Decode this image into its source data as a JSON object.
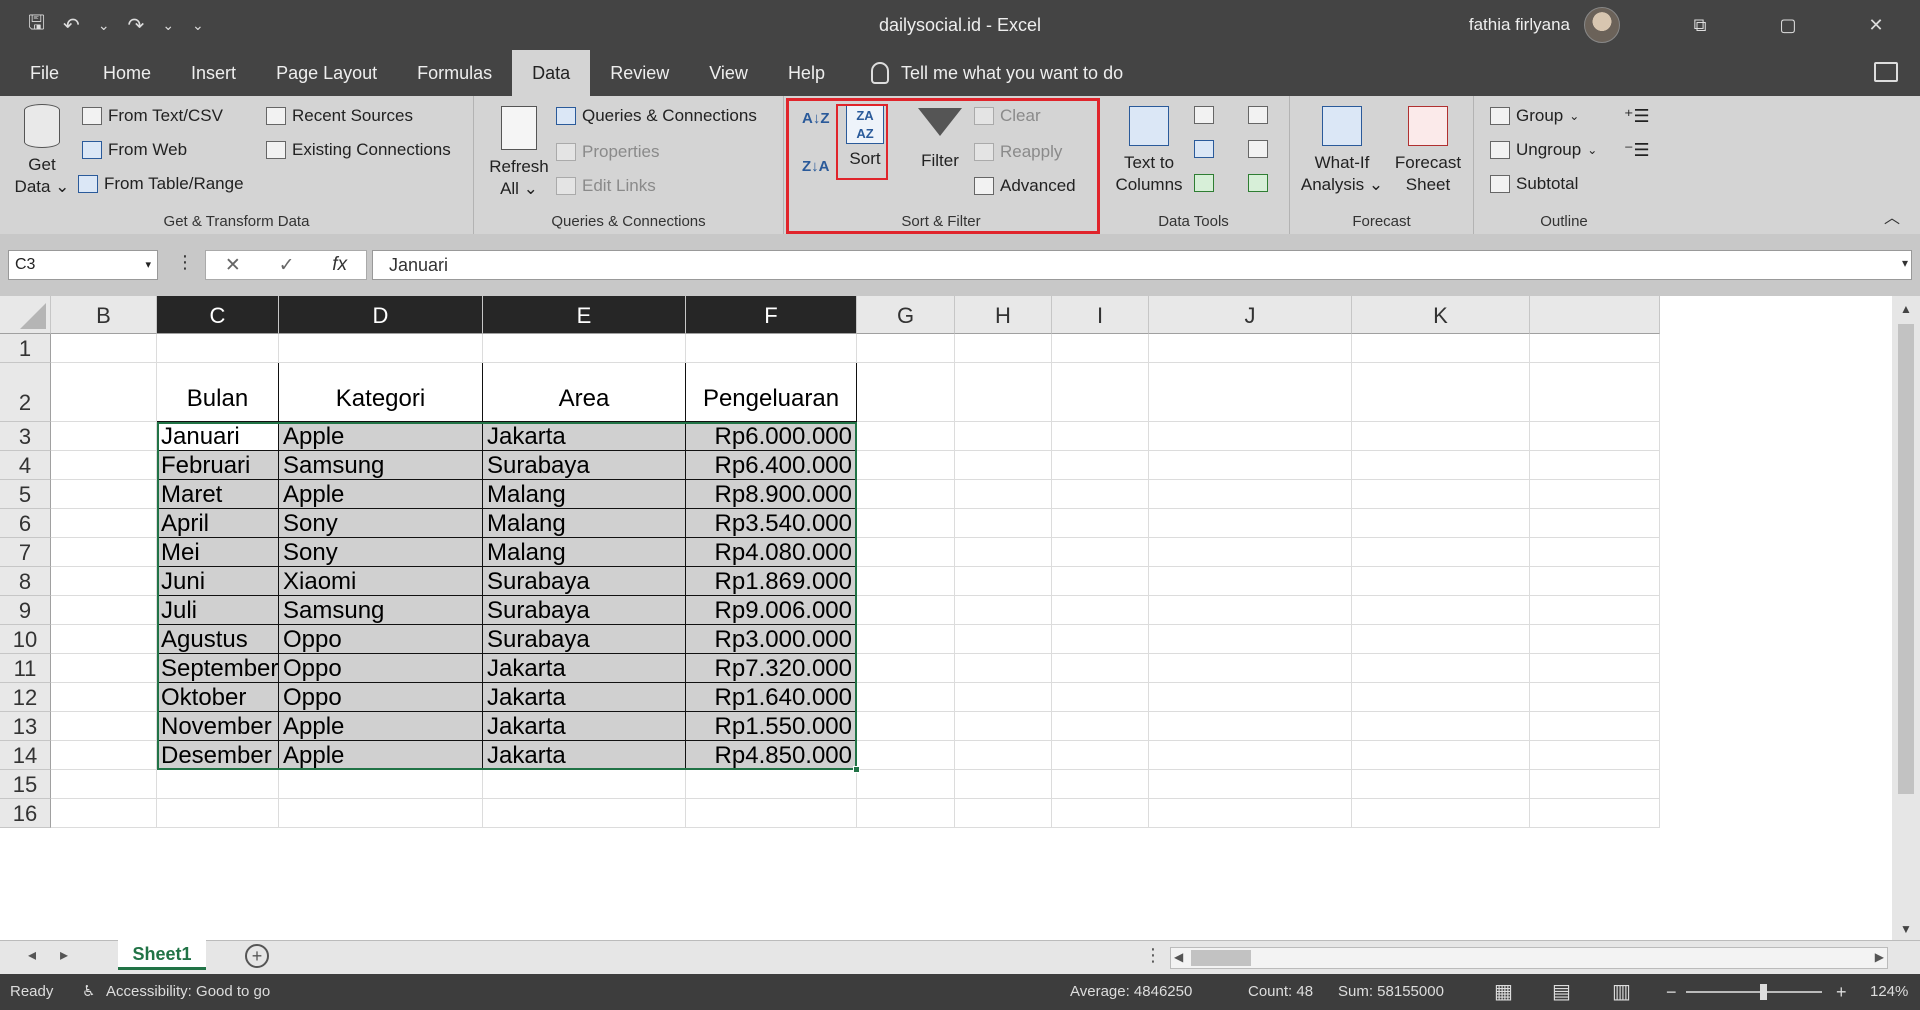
{
  "window": {
    "title": "dailysocial.id  -  Excel",
    "user": "fathia firlyana",
    "controls": [
      "⧉",
      "▢",
      "✕"
    ]
  },
  "qat": {
    "save": "🖫",
    "undo": "↶",
    "undo_drop": "⌄",
    "redo": "↷",
    "redo_drop": "⌄",
    "customize": "⌄"
  },
  "menu": {
    "tabs": [
      "File",
      "Home",
      "Insert",
      "Page Layout",
      "Formulas",
      "Data",
      "Review",
      "View",
      "Help"
    ],
    "active": "Data",
    "tell_me": "Tell me what you want to do"
  },
  "ribbon": {
    "get_transform": {
      "label": "Get & Transform Data",
      "get_data_1": "Get",
      "get_data_2": "Data ⌄",
      "from_text": "From Text/CSV",
      "from_web": "From Web",
      "from_table": "From Table/Range",
      "recent_sources": "Recent Sources",
      "existing_connections": "Existing Connections"
    },
    "queries": {
      "label": "Queries & Connections",
      "refresh_1": "Refresh",
      "refresh_2": "All ⌄",
      "queries_connections": "Queries & Connections",
      "properties": "Properties",
      "edit_links": "Edit Links"
    },
    "sort_filter": {
      "label": "Sort & Filter",
      "sort": "Sort",
      "filter": "Filter",
      "clear": "Clear",
      "reapply": "Reapply",
      "advanced": "Advanced",
      "sort_az": "A↓Z",
      "sort_za": "Z↓A",
      "sort_icon_text": "ZA AZ"
    },
    "data_tools": {
      "label": "Data Tools",
      "text_to_cols_1": "Text to",
      "text_to_cols_2": "Columns"
    },
    "forecast": {
      "label": "Forecast",
      "what_if_1": "What-If",
      "what_if_2": "Analysis ⌄",
      "forecast_1": "Forecast",
      "forecast_2": "Sheet"
    },
    "outline": {
      "label": "Outline",
      "group": "Group",
      "ungroup": "Ungroup",
      "subtotal": "Subtotal"
    }
  },
  "formula_bar": {
    "name_box": "C3",
    "cancel": "✕",
    "enter": "✓",
    "fx": "fx",
    "value": "Januari"
  },
  "columns": [
    "B",
    "C",
    "D",
    "E",
    "F",
    "G",
    "H",
    "I",
    "J",
    "K"
  ],
  "rows": [
    "1",
    "2",
    "3",
    "4",
    "5",
    "6",
    "7",
    "8",
    "9",
    "10",
    "11",
    "12",
    "13",
    "14",
    "15",
    "16"
  ],
  "table": {
    "headers": [
      "Bulan",
      "Kategori",
      "Area",
      "Pengeluaran"
    ],
    "rows": [
      [
        "Januari",
        "Apple",
        "Jakarta",
        "Rp6.000.000"
      ],
      [
        "Februari",
        "Samsung",
        "Surabaya",
        "Rp6.400.000"
      ],
      [
        "Maret",
        "Apple",
        "Malang",
        "Rp8.900.000"
      ],
      [
        "April",
        "Sony",
        "Malang",
        "Rp3.540.000"
      ],
      [
        "Mei",
        "Sony",
        "Malang",
        "Rp4.080.000"
      ],
      [
        "Juni",
        "Xiaomi",
        "Surabaya",
        "Rp1.869.000"
      ],
      [
        "Juli",
        "Samsung",
        "Surabaya",
        "Rp9.006.000"
      ],
      [
        "Agustus",
        "Oppo",
        "Surabaya",
        "Rp3.000.000"
      ],
      [
        "September",
        "Oppo",
        "Jakarta",
        "Rp7.320.000"
      ],
      [
        "Oktober",
        "Oppo",
        "Jakarta",
        "Rp1.640.000"
      ],
      [
        "November",
        "Apple",
        "Jakarta",
        "Rp1.550.000"
      ],
      [
        "Desember",
        "Apple",
        "Jakarta",
        "Rp4.850.000"
      ]
    ]
  },
  "sheets": {
    "active": "Sheet1",
    "add": "+",
    "prev": "◂",
    "next": "▸"
  },
  "status": {
    "ready": "Ready",
    "accessibility": "Accessibility: Good to go",
    "average": "Average: 4846250",
    "count": "Count: 48",
    "sum": "Sum: 58155000",
    "zoom": "124%",
    "zoom_minus": "−",
    "zoom_plus": "+"
  },
  "colors": {
    "accent": "#217346",
    "highlight": "#e0242b",
    "ribbon": "#d4d4d4",
    "titlebar": "#444444"
  }
}
